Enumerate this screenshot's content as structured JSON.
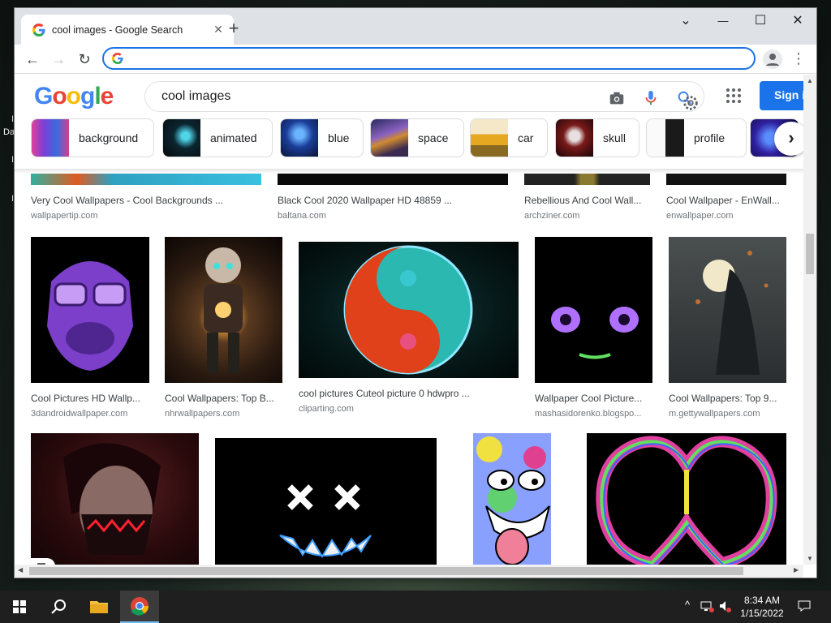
{
  "browser": {
    "tab_title": "cool images - Google Search",
    "tab_close": "✕",
    "new_tab": "+",
    "address_value": "",
    "nav": {
      "back": "←",
      "forward": "→",
      "reload": "↻"
    },
    "window_controls": {
      "dropdown": "⌄",
      "minimize": "—",
      "maximize": "☐",
      "close": "✕"
    },
    "menu": "⋮"
  },
  "google": {
    "logo_letters": [
      {
        "ch": "G",
        "color": "#4285f4"
      },
      {
        "ch": "o",
        "color": "#ea4335"
      },
      {
        "ch": "o",
        "color": "#fbbc05"
      },
      {
        "ch": "g",
        "color": "#4285f4"
      },
      {
        "ch": "l",
        "color": "#34a853"
      },
      {
        "ch": "e",
        "color": "#ea4335"
      }
    ],
    "query": "cool images",
    "signin": "Sign in",
    "chips": [
      "background",
      "animated",
      "blue",
      "space",
      "car",
      "skull",
      "profile"
    ],
    "chip_next": "›"
  },
  "results": {
    "row0": [
      {
        "title": "Very Cool Wallpapers - Cool Backgrounds ...",
        "source": "wallpapertip.com"
      },
      {
        "title": "Black Cool 2020 Wallpaper HD 48859 ...",
        "source": "baltana.com"
      },
      {
        "title": "Rebellious And Cool Wall...",
        "source": "archziner.com"
      },
      {
        "title": "Cool Wallpaper - EnWall...",
        "source": "enwallpaper.com"
      }
    ],
    "row1": [
      {
        "title": "Cool Pictures HD Wallp...",
        "source": "3dandroidwallpaper.com"
      },
      {
        "title": "Cool Wallpapers: Top B...",
        "source": "nhrwallpapers.com"
      },
      {
        "title": "cool pictures Cuteol picture 0 hdwpro ...",
        "source": "cliparting.com"
      },
      {
        "title": "Wallpaper Cool Picture...",
        "source": "mashasidorenko.blogspo..."
      },
      {
        "title": "Cool Wallpapers: Top 9...",
        "source": "m.gettywallpapers.com"
      }
    ]
  },
  "taskbar": {
    "time": "8:34 AM",
    "date": "1/15/2022",
    "tray_chevron": "^"
  },
  "desktop": {
    "labels": [
      "I",
      "Da",
      "I",
      "I"
    ]
  }
}
